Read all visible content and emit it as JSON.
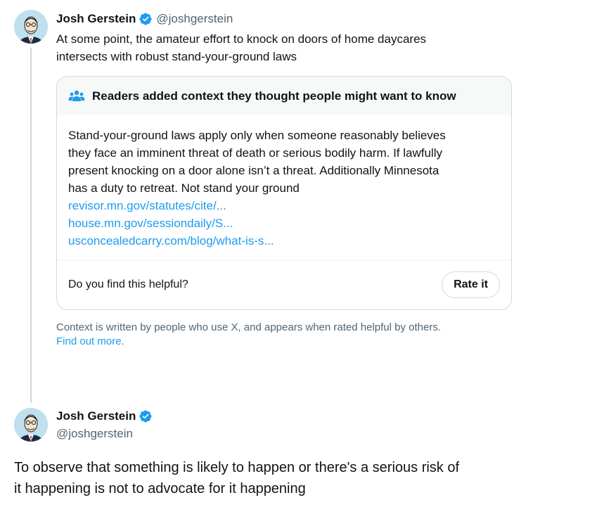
{
  "tweet1": {
    "author_name": "Josh Gerstein",
    "handle": "@joshgerstein",
    "text_lines": [
      "At some point, the amateur effort to knock on doors of home daycares",
      "intersects with robust stand-your-ground laws"
    ]
  },
  "note": {
    "title": "Readers added context they thought people might want to know",
    "body_lines": [
      "Stand-your-ground laws apply only when someone reasonably believes",
      "they face an imminent threat of death or serious bodily harm. If lawfully",
      "present knocking on a door alone isn’t a threat. Additionally Minnesota",
      "has a duty to retreat. Not stand your ground"
    ],
    "links": [
      "revisor.mn.gov/statutes/cite/...",
      "house.mn.gov/sessiondaily/S...",
      "usconcealedcarry.com/blog/what-is-s..."
    ],
    "helpful_question": "Do you find this helpful?",
    "rate_label": "Rate it"
  },
  "context_note": {
    "line1": "Context is written by people who use X, and appears when rated helpful by others.",
    "find_out_more": "Find out more",
    "period": "."
  },
  "tweet2": {
    "author_name": "Josh Gerstein",
    "handle": "@joshgerstein",
    "text_lines": [
      "To observe that something is likely to happen or there's a serious risk of",
      "it happening is not to advocate for it happening"
    ]
  },
  "colors": {
    "accent": "#1d9bf0",
    "secondary_text": "#536471",
    "border": "#cfd9de"
  },
  "icons": {
    "verified": "verified-badge-icon",
    "note_header": "people-icon",
    "avatar": "caricature-avatar"
  }
}
